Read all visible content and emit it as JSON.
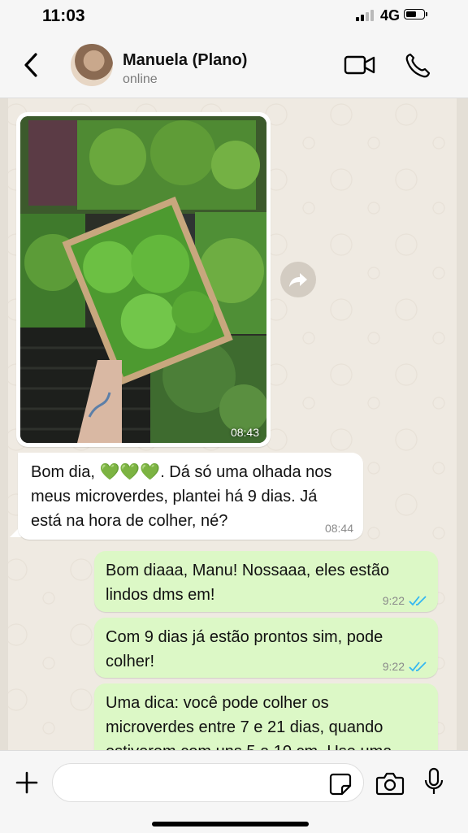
{
  "status_bar": {
    "time": "11:03",
    "network": "4G"
  },
  "header": {
    "contact_name": "Manuela (Plano)",
    "contact_status": "online",
    "icons": [
      "back-chevron-icon",
      "video-call-icon",
      "phone-call-icon"
    ]
  },
  "messages": [
    {
      "type": "image",
      "direction": "in",
      "time": "08:43"
    },
    {
      "type": "text",
      "direction": "in",
      "text": "Bom dia, 💚💚💚. Dá só uma olhada nos\nmeus microverdes, plantei há 9 dias. Já\nestá na hora de colher, né?",
      "time": "08:44"
    },
    {
      "type": "text",
      "direction": "out",
      "text": "Bom diaaa, Manu! Nossaaa, eles estão\nlindos dms em!",
      "time": "9:22",
      "read": true
    },
    {
      "type": "text",
      "direction": "out",
      "text": "Com 9 dias já estão prontos sim, pode\ncolher!",
      "time": "9:22",
      "read": true
    },
    {
      "type": "text",
      "direction": "out",
      "text": "Uma dica: você pode colher os\nmicroverdes entre 7 e 21 dias, quando\nestiverem com uns 5 a 10 cm. Use uma",
      "time": ""
    }
  ],
  "input_bar": {
    "message_value": "",
    "icons": [
      "plus-icon",
      "sticker-icon",
      "camera-icon",
      "microphone-icon"
    ]
  },
  "colors": {
    "incoming_bubble": "#ffffff",
    "outgoing_bubble": "#dcf8c6",
    "read_ticks": "#34b7f1",
    "chat_background": "#efeae2"
  }
}
